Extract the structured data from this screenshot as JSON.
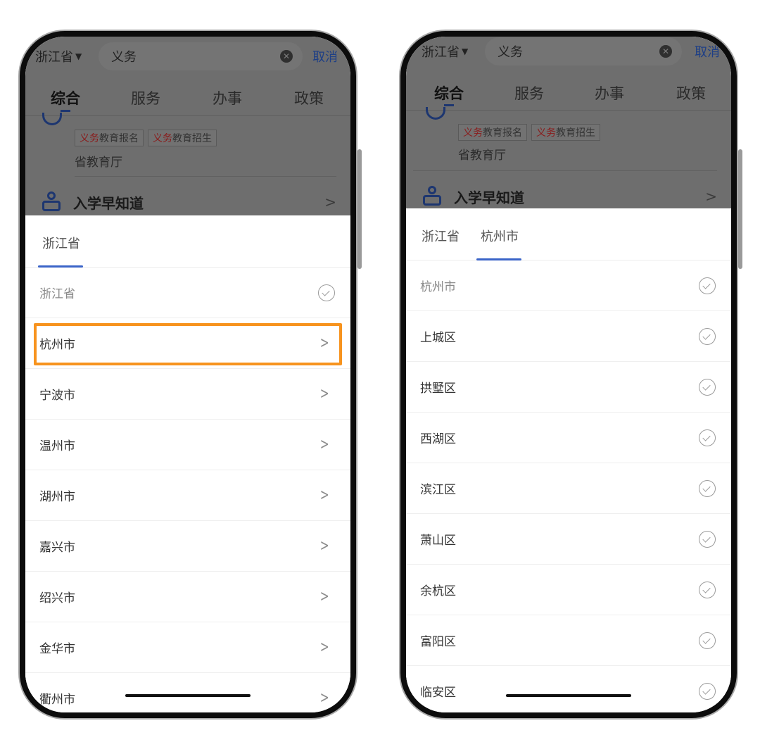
{
  "left_screen": {
    "search": {
      "region": "浙江省",
      "query": "义务",
      "cancel_label": "取消"
    },
    "top_tabs": [
      "综合",
      "服务",
      "办事",
      "政策"
    ],
    "result": {
      "tags": [
        {
          "hl": "义务",
          "rest": "教育报名"
        },
        {
          "hl": "义务",
          "rest": "教育招生"
        }
      ],
      "department": "省教育厅"
    },
    "knowledge_title": "入学早知道",
    "sheet_tabs": [
      "浙江省"
    ],
    "items": [
      {
        "label": "浙江省",
        "type": "check",
        "dim": true
      },
      {
        "label": "杭州市",
        "type": "chevron",
        "highlighted": true
      },
      {
        "label": "宁波市",
        "type": "chevron"
      },
      {
        "label": "温州市",
        "type": "chevron"
      },
      {
        "label": "湖州市",
        "type": "chevron"
      },
      {
        "label": "嘉兴市",
        "type": "chevron"
      },
      {
        "label": "绍兴市",
        "type": "chevron"
      },
      {
        "label": "金华市",
        "type": "chevron"
      },
      {
        "label": "衢州市",
        "type": "chevron"
      }
    ]
  },
  "right_screen": {
    "search": {
      "region": "浙江省",
      "query": "义务",
      "cancel_label": "取消"
    },
    "top_tabs": [
      "综合",
      "服务",
      "办事",
      "政策"
    ],
    "result": {
      "tags": [
        {
          "hl": "义务",
          "rest": "教育报名"
        },
        {
          "hl": "义务",
          "rest": "教育招生"
        }
      ],
      "department": "省教育厅"
    },
    "knowledge_title": "入学早知道",
    "sheet_tabs": [
      "浙江省",
      "杭州市"
    ],
    "items": [
      {
        "label": "杭州市",
        "type": "check",
        "dim": true
      },
      {
        "label": "上城区",
        "type": "check"
      },
      {
        "label": "拱墅区",
        "type": "check"
      },
      {
        "label": "西湖区",
        "type": "check"
      },
      {
        "label": "滨江区",
        "type": "check"
      },
      {
        "label": "萧山区",
        "type": "check"
      },
      {
        "label": "余杭区",
        "type": "check"
      },
      {
        "label": "富阳区",
        "type": "check"
      },
      {
        "label": "临安区",
        "type": "check"
      }
    ]
  },
  "colors": {
    "highlight": "#f7931e",
    "tab_underline": "#3a64c8",
    "link": "#1e3f86"
  }
}
